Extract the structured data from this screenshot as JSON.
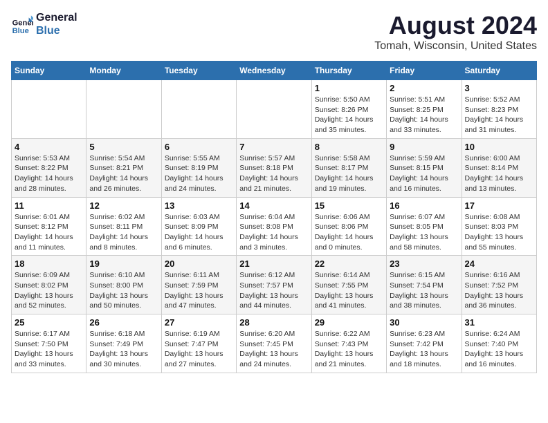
{
  "logo": {
    "line1": "General",
    "line2": "Blue"
  },
  "title": "August 2024",
  "subtitle": "Tomah, Wisconsin, United States",
  "days_of_week": [
    "Sunday",
    "Monday",
    "Tuesday",
    "Wednesday",
    "Thursday",
    "Friday",
    "Saturday"
  ],
  "weeks": [
    [
      {
        "day": "",
        "info": ""
      },
      {
        "day": "",
        "info": ""
      },
      {
        "day": "",
        "info": ""
      },
      {
        "day": "",
        "info": ""
      },
      {
        "day": "1",
        "info": "Sunrise: 5:50 AM\nSunset: 8:26 PM\nDaylight: 14 hours\nand 35 minutes."
      },
      {
        "day": "2",
        "info": "Sunrise: 5:51 AM\nSunset: 8:25 PM\nDaylight: 14 hours\nand 33 minutes."
      },
      {
        "day": "3",
        "info": "Sunrise: 5:52 AM\nSunset: 8:23 PM\nDaylight: 14 hours\nand 31 minutes."
      }
    ],
    [
      {
        "day": "4",
        "info": "Sunrise: 5:53 AM\nSunset: 8:22 PM\nDaylight: 14 hours\nand 28 minutes."
      },
      {
        "day": "5",
        "info": "Sunrise: 5:54 AM\nSunset: 8:21 PM\nDaylight: 14 hours\nand 26 minutes."
      },
      {
        "day": "6",
        "info": "Sunrise: 5:55 AM\nSunset: 8:19 PM\nDaylight: 14 hours\nand 24 minutes."
      },
      {
        "day": "7",
        "info": "Sunrise: 5:57 AM\nSunset: 8:18 PM\nDaylight: 14 hours\nand 21 minutes."
      },
      {
        "day": "8",
        "info": "Sunrise: 5:58 AM\nSunset: 8:17 PM\nDaylight: 14 hours\nand 19 minutes."
      },
      {
        "day": "9",
        "info": "Sunrise: 5:59 AM\nSunset: 8:15 PM\nDaylight: 14 hours\nand 16 minutes."
      },
      {
        "day": "10",
        "info": "Sunrise: 6:00 AM\nSunset: 8:14 PM\nDaylight: 14 hours\nand 13 minutes."
      }
    ],
    [
      {
        "day": "11",
        "info": "Sunrise: 6:01 AM\nSunset: 8:12 PM\nDaylight: 14 hours\nand 11 minutes."
      },
      {
        "day": "12",
        "info": "Sunrise: 6:02 AM\nSunset: 8:11 PM\nDaylight: 14 hours\nand 8 minutes."
      },
      {
        "day": "13",
        "info": "Sunrise: 6:03 AM\nSunset: 8:09 PM\nDaylight: 14 hours\nand 6 minutes."
      },
      {
        "day": "14",
        "info": "Sunrise: 6:04 AM\nSunset: 8:08 PM\nDaylight: 14 hours\nand 3 minutes."
      },
      {
        "day": "15",
        "info": "Sunrise: 6:06 AM\nSunset: 8:06 PM\nDaylight: 14 hours\nand 0 minutes."
      },
      {
        "day": "16",
        "info": "Sunrise: 6:07 AM\nSunset: 8:05 PM\nDaylight: 13 hours\nand 58 minutes."
      },
      {
        "day": "17",
        "info": "Sunrise: 6:08 AM\nSunset: 8:03 PM\nDaylight: 13 hours\nand 55 minutes."
      }
    ],
    [
      {
        "day": "18",
        "info": "Sunrise: 6:09 AM\nSunset: 8:02 PM\nDaylight: 13 hours\nand 52 minutes."
      },
      {
        "day": "19",
        "info": "Sunrise: 6:10 AM\nSunset: 8:00 PM\nDaylight: 13 hours\nand 50 minutes."
      },
      {
        "day": "20",
        "info": "Sunrise: 6:11 AM\nSunset: 7:59 PM\nDaylight: 13 hours\nand 47 minutes."
      },
      {
        "day": "21",
        "info": "Sunrise: 6:12 AM\nSunset: 7:57 PM\nDaylight: 13 hours\nand 44 minutes."
      },
      {
        "day": "22",
        "info": "Sunrise: 6:14 AM\nSunset: 7:55 PM\nDaylight: 13 hours\nand 41 minutes."
      },
      {
        "day": "23",
        "info": "Sunrise: 6:15 AM\nSunset: 7:54 PM\nDaylight: 13 hours\nand 38 minutes."
      },
      {
        "day": "24",
        "info": "Sunrise: 6:16 AM\nSunset: 7:52 PM\nDaylight: 13 hours\nand 36 minutes."
      }
    ],
    [
      {
        "day": "25",
        "info": "Sunrise: 6:17 AM\nSunset: 7:50 PM\nDaylight: 13 hours\nand 33 minutes."
      },
      {
        "day": "26",
        "info": "Sunrise: 6:18 AM\nSunset: 7:49 PM\nDaylight: 13 hours\nand 30 minutes."
      },
      {
        "day": "27",
        "info": "Sunrise: 6:19 AM\nSunset: 7:47 PM\nDaylight: 13 hours\nand 27 minutes."
      },
      {
        "day": "28",
        "info": "Sunrise: 6:20 AM\nSunset: 7:45 PM\nDaylight: 13 hours\nand 24 minutes."
      },
      {
        "day": "29",
        "info": "Sunrise: 6:22 AM\nSunset: 7:43 PM\nDaylight: 13 hours\nand 21 minutes."
      },
      {
        "day": "30",
        "info": "Sunrise: 6:23 AM\nSunset: 7:42 PM\nDaylight: 13 hours\nand 18 minutes."
      },
      {
        "day": "31",
        "info": "Sunrise: 6:24 AM\nSunset: 7:40 PM\nDaylight: 13 hours\nand 16 minutes."
      }
    ]
  ]
}
